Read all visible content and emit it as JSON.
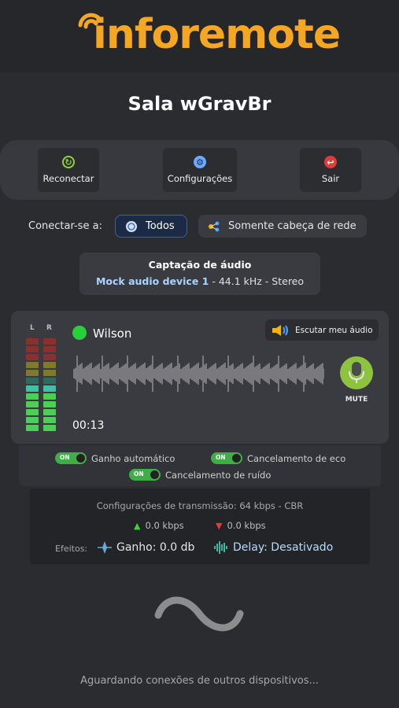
{
  "brand": {
    "logo_text": "inforemote",
    "color": "#f5a623"
  },
  "room": {
    "title": "Sala wGravBr"
  },
  "actions": [
    {
      "label": "Reconectar",
      "icon": "refresh-icon",
      "color": "#8fd13f"
    },
    {
      "label": "Configurações",
      "icon": "gear-icon",
      "color": "#6aa9ff"
    },
    {
      "label": "Sair",
      "icon": "exit-icon",
      "color": "#e23b3b"
    }
  ],
  "connect": {
    "label": "Conectar-se a:",
    "options": [
      {
        "label": "Todos",
        "icon": "globe-icon",
        "selected": true
      },
      {
        "label": "Somente cabeça de rede",
        "icon": "network-icon",
        "selected": false
      }
    ]
  },
  "capture": {
    "title": "Captação de áudio",
    "device": "Mock audio device 1",
    "details": " - 44.1 kHz - Stereo"
  },
  "participant": {
    "meter_left_label": "L",
    "meter_right_label": "R",
    "name": "Wilson",
    "status_color": "#27d13a",
    "listen_button": "Escutar meu áudio",
    "timer": "00:13",
    "mute_label": "MUTE",
    "meter_level": 0.5
  },
  "toggles": [
    {
      "label": "Ganho automático",
      "state": "ON"
    },
    {
      "label": "Cancelamento de eco",
      "state": "ON"
    },
    {
      "label": "Cancelamento de ruído",
      "state": "ON"
    }
  ],
  "transmission": {
    "config": "Configurações de transmissão: 64 kbps - CBR",
    "upload": "0.0 kbps",
    "download": "0.0 kbps",
    "effects_label": "Efeitos:",
    "gain": "Ganho: 0.0 db",
    "delay": "Delay: Desativado"
  },
  "footer": {
    "waiting": "Aguardando conexões de outros dispositivos..."
  }
}
